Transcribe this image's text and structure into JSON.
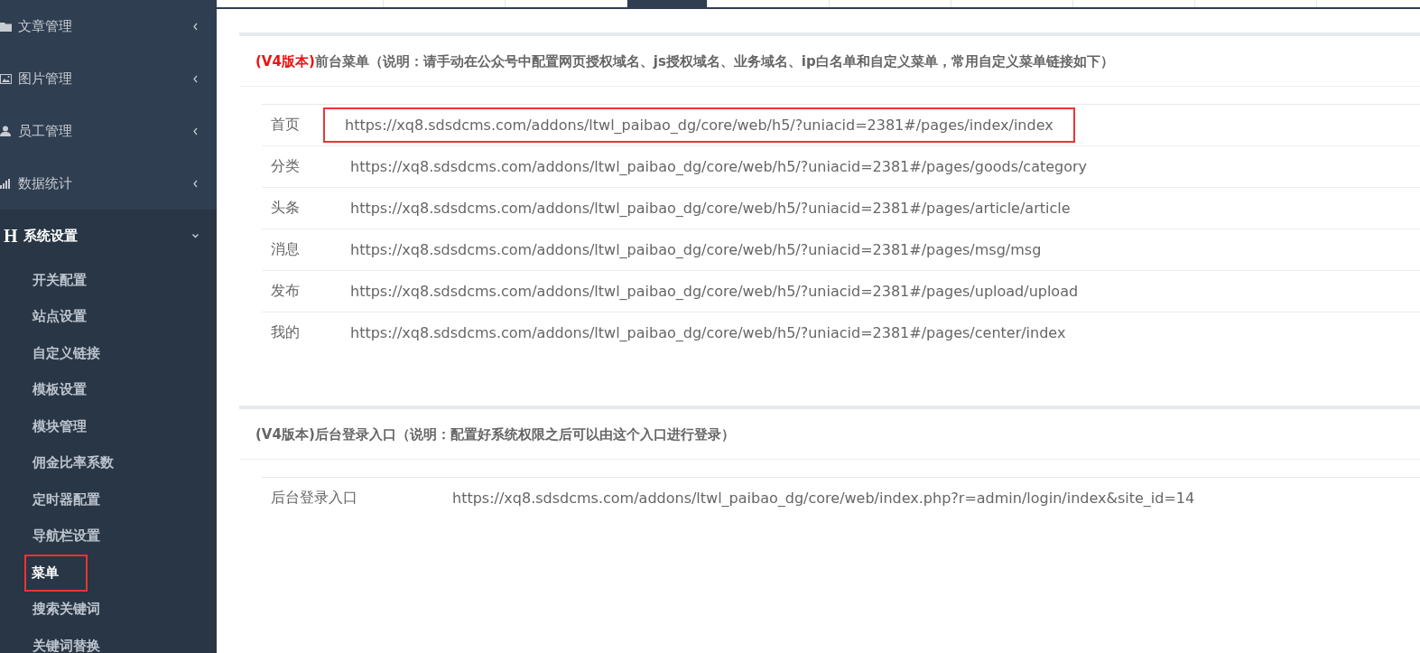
{
  "sidebar": {
    "items": [
      {
        "label": "文章管理",
        "kind": "folder",
        "expanded": false
      },
      {
        "label": "图片管理",
        "kind": "picture",
        "expanded": false
      },
      {
        "label": "员工管理",
        "kind": "user",
        "expanded": false
      },
      {
        "label": "数据统计",
        "kind": "chart",
        "expanded": false
      },
      {
        "label": "系统设置",
        "kind": "letter",
        "icon_text": "H",
        "expanded": true,
        "children": [
          {
            "label": "开关配置",
            "selected": false,
            "highlighted": false
          },
          {
            "label": "站点设置",
            "selected": false,
            "highlighted": false
          },
          {
            "label": "自定义链接",
            "selected": false,
            "highlighted": false
          },
          {
            "label": "模板设置",
            "selected": false,
            "highlighted": false
          },
          {
            "label": "模块管理",
            "selected": false,
            "highlighted": false
          },
          {
            "label": "佣金比率系数",
            "selected": false,
            "highlighted": false
          },
          {
            "label": "定时器配置",
            "selected": false,
            "highlighted": false
          },
          {
            "label": "导航栏设置",
            "selected": false,
            "highlighted": false
          },
          {
            "label": "菜单",
            "selected": true,
            "highlighted": true
          },
          {
            "label": "搜索关键词",
            "selected": false,
            "highlighted": false
          },
          {
            "label": "关键词替换",
            "selected": false,
            "highlighted": false
          }
        ]
      }
    ]
  },
  "tabs": [
    {
      "selected": false
    },
    {
      "selected": false
    },
    {
      "selected": false
    },
    {
      "selected": true
    },
    {
      "selected": false
    },
    {
      "selected": false
    },
    {
      "selected": false
    },
    {
      "selected": false
    },
    {
      "selected": false
    }
  ],
  "panels": [
    {
      "title": "**(V4版本)**前台菜单（说明：请手动在公众号中配置网页授权域名、js授权域名、业务域名、ip白名单和自定义菜单，常用自定义菜单链接如下）",
      "kind": "menu",
      "rows": [
        {
          "name": "首页",
          "url": "https://xq8.sdsdcms.com/addons/ltwl_paibao_dg/core/web/h5/?uniacid=2381#/pages/index/index",
          "highlighted": true
        },
        {
          "name": "分类",
          "url": "https://xq8.sdsdcms.com/addons/ltwl_paibao_dg/core/web/h5/?uniacid=2381#/pages/goods/category",
          "highlighted": false
        },
        {
          "name": "头条",
          "url": "https://xq8.sdsdcms.com/addons/ltwl_paibao_dg/core/web/h5/?uniacid=2381#/pages/article/article",
          "highlighted": false
        },
        {
          "name": "消息",
          "url": "https://xq8.sdsdcms.com/addons/ltwl_paibao_dg/core/web/h5/?uniacid=2381#/pages/msg/msg",
          "highlighted": false
        },
        {
          "name": "发布",
          "url": "https://xq8.sdsdcms.com/addons/ltwl_paibao_dg/core/web/h5/?uniacid=2381#/pages/upload/upload",
          "highlighted": false
        },
        {
          "name": "我的",
          "url": "https://xq8.sdsdcms.com/addons/ltwl_paibao_dg/core/web/h5/?uniacid=2381#/pages/center/index",
          "highlighted": false
        }
      ]
    },
    {
      "title": "(V4版本)后台登录入口（说明：配置好系统权限之后可以由这个入口进行登录）",
      "kind": "login",
      "rows": [
        {
          "name": "后台登录入口",
          "url": "https://xq8.sdsdcms.com/addons/ltwl_paibao_dg/core/web/index.php?r=admin/login/index&site_id=14",
          "highlighted": false
        }
      ]
    }
  ]
}
